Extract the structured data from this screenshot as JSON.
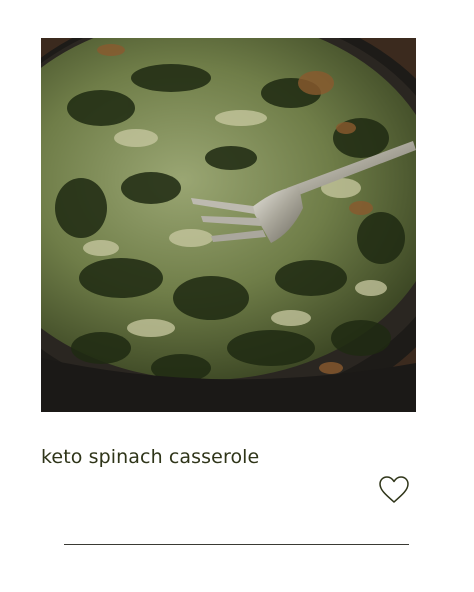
{
  "recipe_card": {
    "title": "keto spinach casserole",
    "image_subject": "spinach casserole in cast-iron skillet with fork",
    "favorite_icon": "heart-outline-icon"
  },
  "colors": {
    "title_text": "#2f3519",
    "divider": "#3a3a34",
    "background": "#ffffff"
  }
}
